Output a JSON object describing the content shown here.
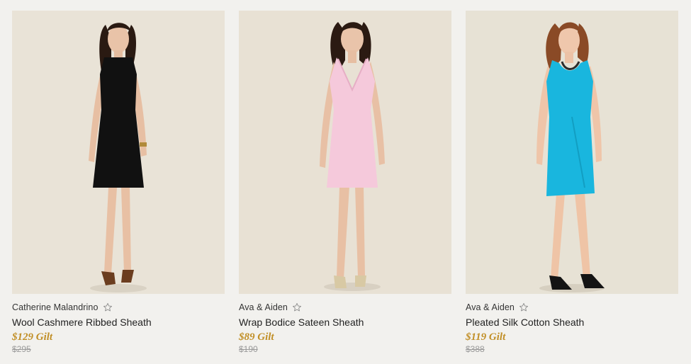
{
  "products": [
    {
      "brand": "Catherine Malandrino",
      "name": "Wool Cashmere Ribbed Sheath",
      "sale_price": "$129 Gilt",
      "msrp": "$295",
      "dress_color": "#111111",
      "hair_color": "#2a1a12"
    },
    {
      "brand": "Ava & Aiden",
      "name": "Wrap Bodice Sateen Sheath",
      "sale_price": "$89 Gilt",
      "msrp": "$190",
      "dress_color": "#f5c9db",
      "hair_color": "#2b1a12"
    },
    {
      "brand": "Ava & Aiden",
      "name": "Pleated Silk Cotton Sheath",
      "sale_price": "$119 Gilt",
      "msrp": "$388",
      "dress_color": "#19b6de",
      "hair_color": "#8a4a26"
    }
  ],
  "colors": {
    "background": "#f2f1ee",
    "photo_backdrop": "#e8e2d6",
    "price_accent": "#c18f27",
    "msrp_gray": "#9a9a9a"
  },
  "icons": {
    "favorite": "star-outline-icon"
  }
}
